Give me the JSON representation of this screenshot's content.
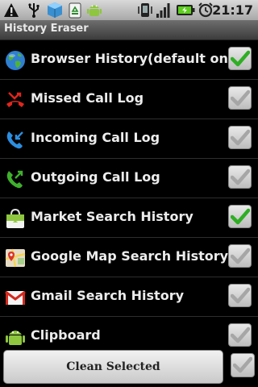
{
  "status_bar": {
    "time": "21:17",
    "icons": [
      "warning-icon",
      "usb-icon",
      "box-icon",
      "recycle-icon",
      "android-icon",
      "phone-vibrate-icon",
      "signal-icon",
      "battery-charging-icon",
      "alarm-clock-icon"
    ]
  },
  "app": {
    "title": "History Eraser"
  },
  "items": [
    {
      "label": "Browser History(default only)",
      "icon": "globe-icon",
      "checked": true
    },
    {
      "label": "Missed Call Log",
      "icon": "missed-call-icon",
      "checked": false
    },
    {
      "label": "Incoming Call Log",
      "icon": "incoming-call-icon",
      "checked": false
    },
    {
      "label": "Outgoing Call Log",
      "icon": "outgoing-call-icon",
      "checked": false
    },
    {
      "label": "Market Search History",
      "icon": "market-bag-icon",
      "checked": true
    },
    {
      "label": "Google Map Search History",
      "icon": "map-icon",
      "checked": false
    },
    {
      "label": "Gmail Search History",
      "icon": "gmail-icon",
      "checked": false
    },
    {
      "label": "Clipboard",
      "icon": "android-clipboard-icon",
      "checked": false
    }
  ],
  "footer": {
    "clean_button": "Clean Selected",
    "select_all_checked": false
  },
  "colors": {
    "check_green": "#2fae24",
    "check_gray": "#a6a6a6"
  }
}
